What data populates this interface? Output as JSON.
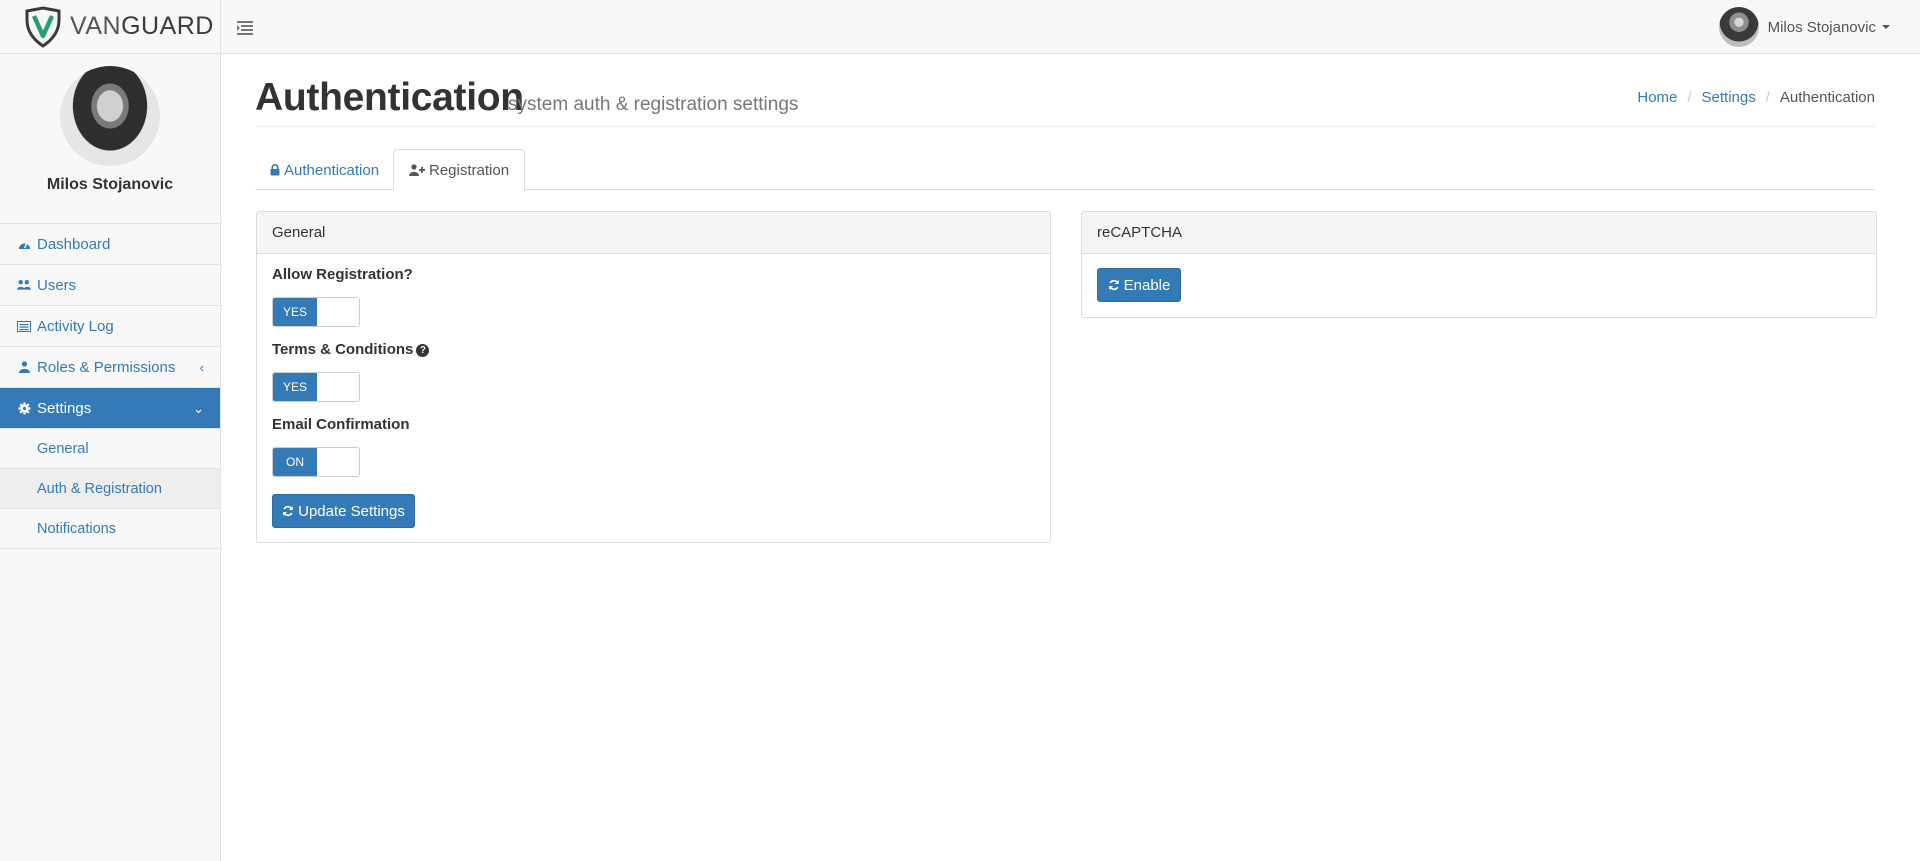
{
  "brand": {
    "name_light": "VAN",
    "name_bold": "GUARD"
  },
  "topbar": {
    "user_name": "Milos Stojanovic"
  },
  "sidebar": {
    "profile_name": "Milos Stojanovic",
    "items": [
      {
        "label": "Dashboard",
        "icon": "dashboard-icon"
      },
      {
        "label": "Users",
        "icon": "users-icon"
      },
      {
        "label": "Activity Log",
        "icon": "list-icon"
      },
      {
        "label": "Roles & Permissions",
        "icon": "user-icon",
        "chevron": "‹"
      },
      {
        "label": "Settings",
        "icon": "gear-icon",
        "chevron": "⌄",
        "active": true
      }
    ],
    "sub_items": [
      {
        "label": "General"
      },
      {
        "label": "Auth & Registration",
        "current": true
      },
      {
        "label": "Notifications"
      }
    ]
  },
  "header": {
    "title": "Authentication",
    "subtitle": "system auth & registration settings",
    "breadcrumb": [
      "Home",
      "Settings",
      "Authentication"
    ]
  },
  "tabs": [
    {
      "label": "Authentication",
      "icon": "lock-icon"
    },
    {
      "label": "Registration",
      "icon": "user-plus-icon",
      "active": true
    }
  ],
  "general_panel": {
    "title": "General",
    "fields": [
      {
        "label": "Allow Registration?",
        "toggle": "YES"
      },
      {
        "label": "Terms & Conditions",
        "toggle": "YES",
        "help": "?"
      },
      {
        "label": "Email Confirmation",
        "toggle": "ON"
      }
    ],
    "submit_label": "Update Settings"
  },
  "recaptcha_panel": {
    "title": "reCAPTCHA",
    "button_label": "Enable"
  },
  "colors": {
    "primary": "#337ab7",
    "sidebar_bg": "#f8f8f8",
    "brand_green": "#2a9d72"
  }
}
